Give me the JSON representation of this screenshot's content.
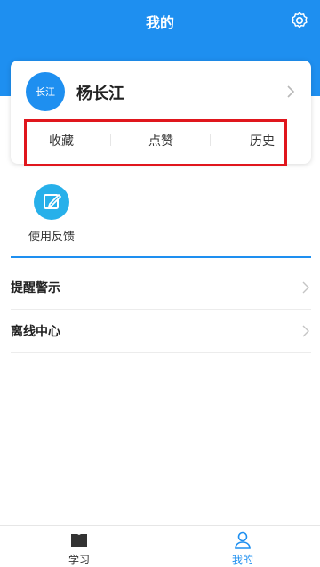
{
  "header": {
    "title": "我的"
  },
  "profile": {
    "avatar_text": "长江",
    "name": "杨长江"
  },
  "stats": {
    "favorites": "收藏",
    "likes": "点赞",
    "history": "历史"
  },
  "tools": {
    "feedback": "使用反馈"
  },
  "menu": [
    {
      "label": "提醒警示"
    },
    {
      "label": "离线中心"
    }
  ],
  "tabbar": {
    "study": "学习",
    "mine": "我的"
  },
  "colors": {
    "primary": "#1e8ff0",
    "highlight": "#e0161d",
    "feedback_icon": "#27b0ea"
  }
}
